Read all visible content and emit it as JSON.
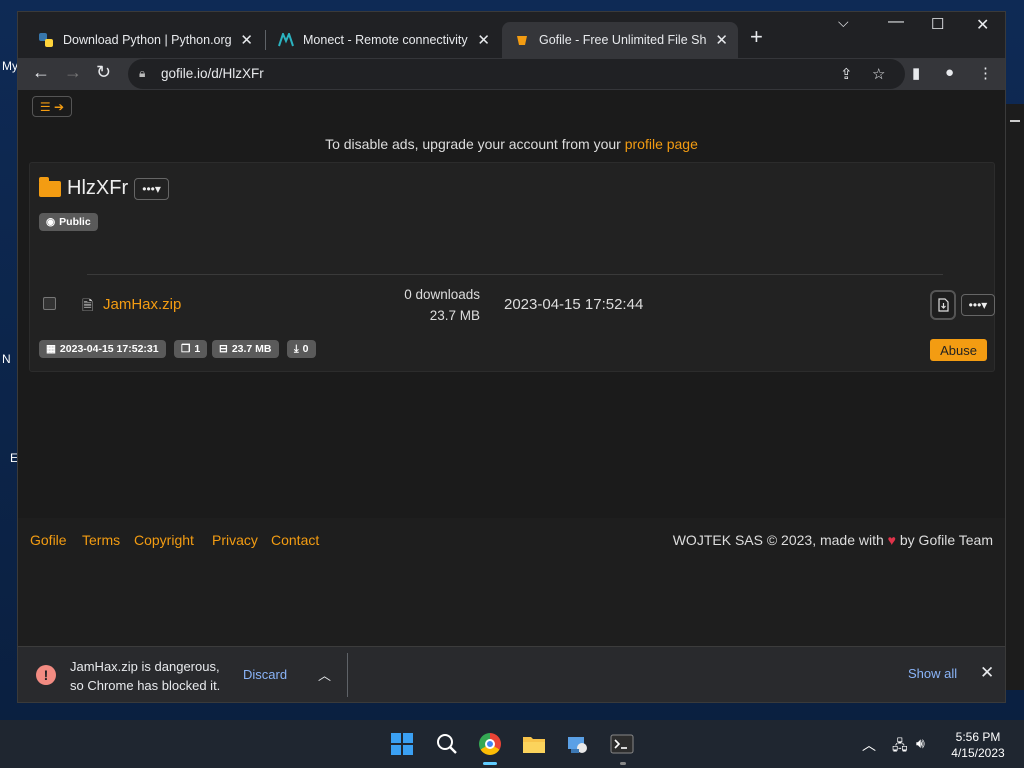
{
  "desktop": {
    "labels": [
      "My",
      "N",
      "E"
    ]
  },
  "browser": {
    "tabs": [
      {
        "title": "Download Python | Python.org",
        "favicon": "python-icon"
      },
      {
        "title": "Monect - Remote connectivity | I",
        "favicon": "monect-icon"
      },
      {
        "title": "Gofile - Free Unlimited File Shari",
        "favicon": "gofile-icon"
      }
    ],
    "address": "gofile.io/d/HlzXFr"
  },
  "page": {
    "ads_text": "To disable ads, upgrade your account from your",
    "ads_link": "profile page",
    "folder": {
      "name": "HlzXFr",
      "visibility": "Public",
      "created": "2023-04-15 17:52:31",
      "file_count": "1",
      "total_size": "23.7 MB",
      "downloads": "0"
    },
    "file": {
      "name": "JamHax.zip",
      "downloads": "0 downloads",
      "size": "23.7 MB",
      "date": "2023-04-15 17:52:44"
    },
    "abuse_label": "Abuse",
    "footer": {
      "links": [
        "Gofile",
        "Terms",
        "Copyright",
        "Privacy",
        "Contact"
      ],
      "copyright_before": "WOJTEK SAS © 2023, made with",
      "copyright_after": "by Gofile Team"
    }
  },
  "download_bar": {
    "message_line1": "JamHax.zip is dangerous,",
    "message_line2": "so Chrome has blocked it.",
    "discard": "Discard",
    "show_all": "Show all"
  },
  "taskbar": {
    "time": "5:56 PM",
    "date": "4/15/2023"
  },
  "colors": {
    "accent": "#f39c12",
    "link_blue": "#8ab4f8",
    "danger": "#f28b82"
  }
}
